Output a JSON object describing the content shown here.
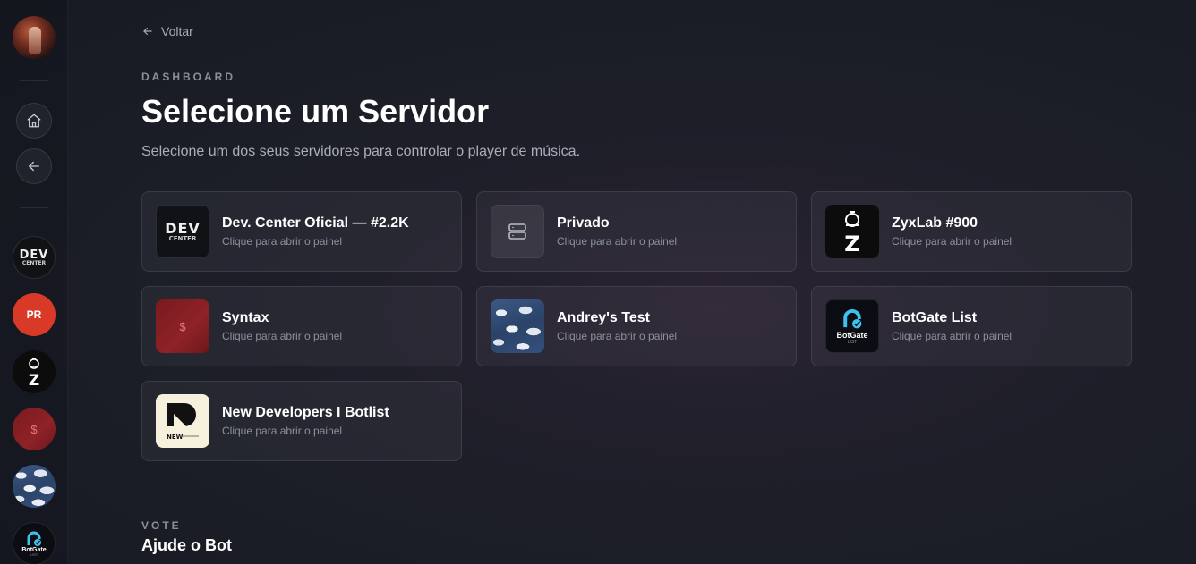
{
  "sidebar": {
    "servers": [
      {
        "name": "Dev. Center Oficial — #2.2K",
        "icon_text": [
          "DEV",
          "CENTER"
        ]
      },
      {
        "name": "Privado",
        "icon_text": "PR"
      },
      {
        "name": "ZyxLab #900",
        "icon_text": "Z"
      },
      {
        "name": "Syntax",
        "icon_text": "$"
      },
      {
        "name": "Andrey's Test"
      },
      {
        "name": "BotGate List",
        "icon_text": [
          "BotGate",
          "LIST"
        ]
      }
    ]
  },
  "header": {
    "back_label": "Voltar",
    "eyebrow": "DASHBOARD",
    "title": "Selecione um Servidor",
    "subtitle": "Selecione um dos seus servidores para controlar o player de música."
  },
  "servers": [
    {
      "name": "Dev. Center Oficial — #2.2K",
      "hint": "Clique para abrir o painel",
      "icon": "dev-center",
      "icon_text": [
        "DEV",
        "CENTER"
      ]
    },
    {
      "name": "Privado",
      "hint": "Clique para abrir o painel",
      "icon": "server-icon"
    },
    {
      "name": "ZyxLab #900",
      "hint": "Clique para abrir o painel",
      "icon": "zyxlab",
      "icon_text": "Z"
    },
    {
      "name": "Syntax",
      "hint": "Clique para abrir o painel",
      "icon": "syntax",
      "icon_text": "$"
    },
    {
      "name": "Andrey's Test",
      "hint": "Clique para abrir o painel",
      "icon": "clouds"
    },
    {
      "name": "BotGate List",
      "hint": "Clique para abrir o painel",
      "icon": "botgate",
      "icon_text": [
        "BotGate",
        "LIST"
      ]
    },
    {
      "name": "New Developers I Botlist",
      "hint": "Clique para abrir o painel",
      "icon": "new-developers",
      "icon_text": "NEW"
    }
  ],
  "vote": {
    "eyebrow": "VOTE",
    "title": "Ajude o Bot"
  },
  "colors": {
    "background": "#1c1e27",
    "card": "#262830",
    "accent_red": "#d93a27",
    "botgate_cyan": "#3cc2ee"
  }
}
